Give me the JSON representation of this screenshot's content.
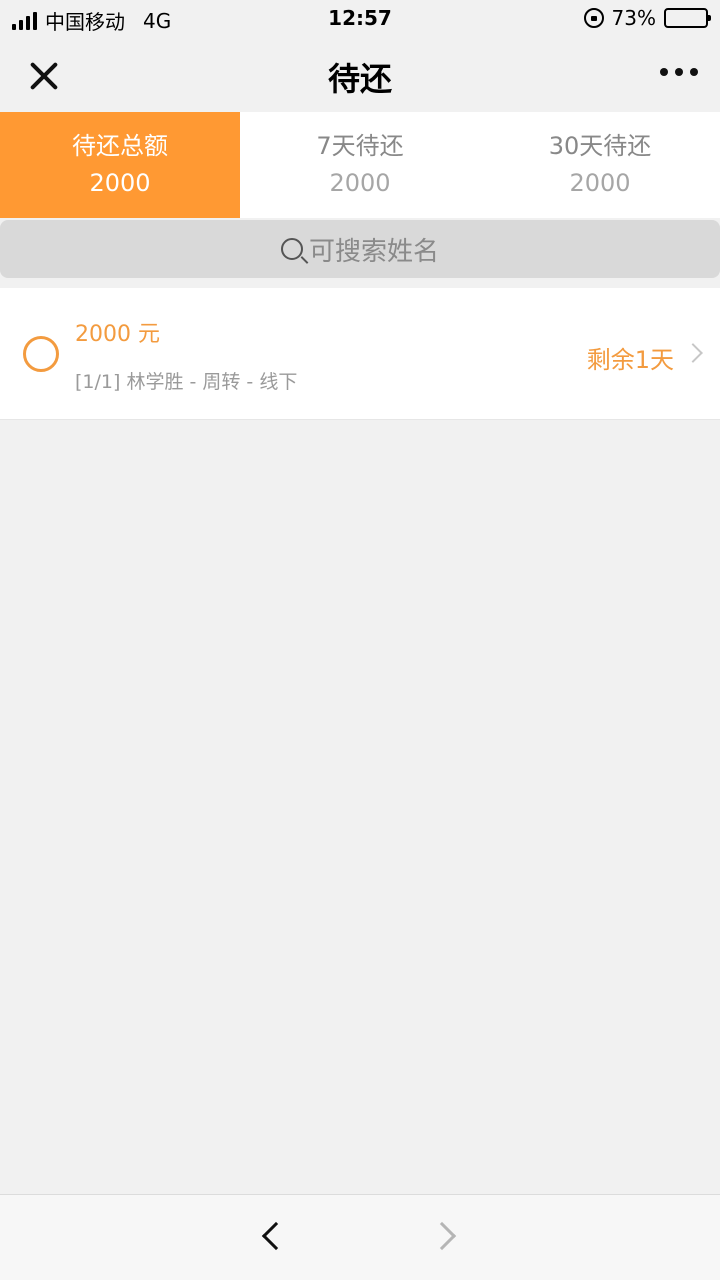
{
  "status_bar": {
    "carrier": "中国移动",
    "network": "4G",
    "time": "12:57",
    "battery": "73%",
    "battery_level": 0.73
  },
  "header": {
    "title": "待还"
  },
  "tabs": [
    {
      "label": "待还总额",
      "value": "2000"
    },
    {
      "label": "7天待还",
      "value": "2000"
    },
    {
      "label": "30天待还",
      "value": "2000"
    }
  ],
  "search": {
    "placeholder": "可搜索姓名"
  },
  "list": {
    "items": [
      {
        "amount": "2000 元",
        "desc": "[1/1] 林学胜 - 周转 - 线下",
        "remaining": "剩余1天"
      }
    ]
  },
  "colors": {
    "accent": "#ff9933",
    "accent_text": "#f39b3f",
    "background": "#f1f1f1"
  },
  "icons": {
    "close": "close-icon",
    "more": "more-icon",
    "search": "search-icon",
    "radio": "radio-circle-icon",
    "chevron": "chevron-right-icon",
    "back": "back-arrow-icon",
    "forward": "forward-arrow-icon"
  }
}
